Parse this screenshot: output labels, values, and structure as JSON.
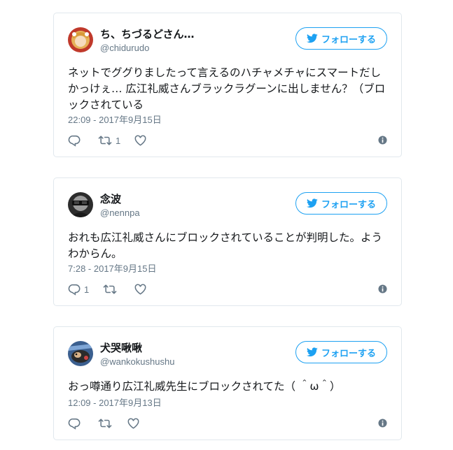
{
  "follow_label": "フォローする",
  "colors": {
    "accent": "#1da1f2",
    "secondary": "#657786",
    "border": "#e1e8ed"
  },
  "tweets": [
    {
      "name": "ち、ちづるどさん…",
      "handle": "@chidurudo",
      "text": "ネットでググりましたって言えるのハチャメチャにスマートだしかっけぇ… 広江礼威さんブラックラグーンに出しません？（ブロックされている",
      "time": "22:09 - 2017年9月15日",
      "reply_count": "",
      "retweet_count": "1",
      "avatar_icon": "anime-avatar-icon"
    },
    {
      "name": "念波",
      "handle": "@nennpa",
      "text": "おれも広江礼威さんにブロックされていることが判明した。ようわからん。",
      "time": "7:28 - 2017年9月15日",
      "reply_count": "1",
      "retweet_count": "",
      "avatar_icon": "sunglasses-avatar-icon"
    },
    {
      "name": "犬哭啾啾",
      "handle": "@wankokushushu",
      "text": "おっ噂通り広江礼威先生にブロックされてた（ ＾ω＾）",
      "time": "12:09 - 2017年9月13日",
      "reply_count": "",
      "retweet_count": "",
      "avatar_icon": "dog-avatar-icon"
    }
  ]
}
